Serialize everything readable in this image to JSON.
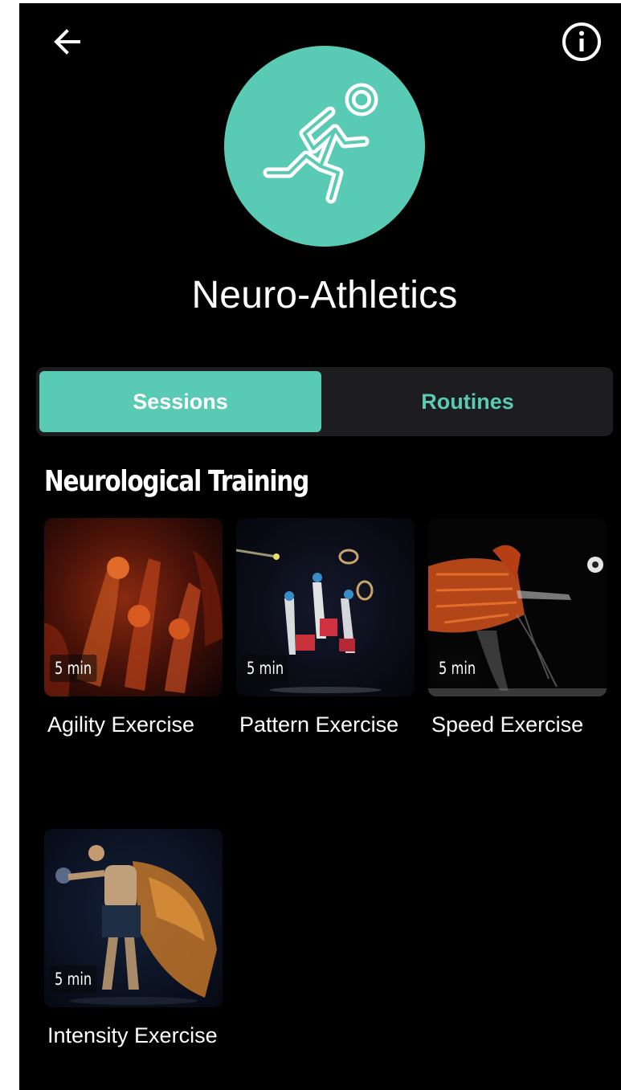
{
  "header": {
    "back_icon": "arrow-left-icon",
    "info_icon": "info-circle-icon",
    "hero_icon": "runner-icon",
    "title": "Neuro-Athletics"
  },
  "colors": {
    "accent": "#59cbb4",
    "background": "#000000",
    "tab_track": "#1d1d1f"
  },
  "tabs": [
    {
      "label": "Sessions",
      "selected": true
    },
    {
      "label": "Routines",
      "selected": false
    }
  ],
  "section": {
    "title": "Neurological Training",
    "exercises": [
      {
        "label": "Agility Exercise",
        "duration": "5 min"
      },
      {
        "label": "Pattern Exercise",
        "duration": "5 min"
      },
      {
        "label": "Speed Exercise",
        "duration": "5 min"
      },
      {
        "label": "Intensity Exercise",
        "duration": "5 min"
      }
    ]
  }
}
